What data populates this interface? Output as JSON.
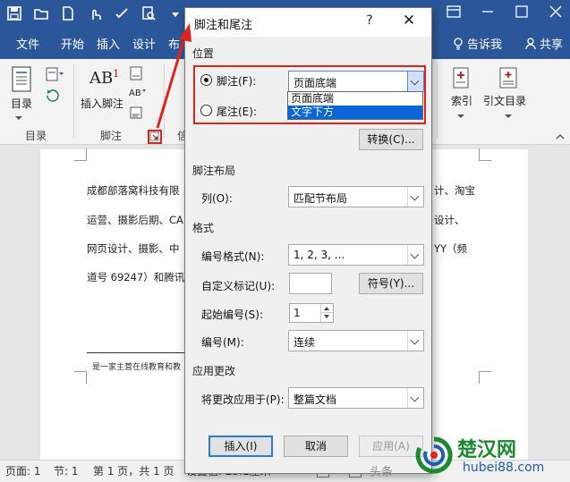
{
  "word": {
    "tabs": [
      "文件",
      "开始",
      "插入",
      "设计",
      "布"
    ],
    "tell_me": "告诉我",
    "share": "共享",
    "ribbon": {
      "toc_button": "目录",
      "toc_group": "目录",
      "insert_footnote_button": "插入脚注",
      "footnotes_group": "脚注",
      "citations_group_partial": "信",
      "index_button": "索引",
      "table_of_authorities_button": "引文目录",
      "ab_icon_text": "AB",
      "ab_superscript": "1"
    },
    "document_lines": [
      "成都部落窝科技有限",
      "运营、摄影后期、CA",
      "网页设计、摄影、中",
      "道号 69247）和腾讯"
    ],
    "document_lines_right": [
      "计、淘宝",
      "设计、",
      "YY（频",
      ""
    ],
    "footnote_text": "是一家主营在线教育和教",
    "status": {
      "page": "页面: 1",
      "section": "节: 1",
      "pages": "第 1 页，共 1 页",
      "position": "设置值: 23.1厘米"
    }
  },
  "dialog": {
    "title": "脚注和尾注",
    "help": "?",
    "close": "✕",
    "location_section": "位置",
    "footnote_label": "脚注(F):",
    "footnote_value": "页面底端",
    "endnote_label": "尾注(E):",
    "dropdown_options": [
      "页面底端",
      "文字下方"
    ],
    "dropdown_selected_index": 1,
    "convert_button": "转换(C)...",
    "layout_section": "脚注布局",
    "columns_label": "列(O):",
    "columns_value": "匹配节布局",
    "format_section": "格式",
    "number_format_label": "编号格式(N):",
    "number_format_value": "1, 2, 3, ...",
    "custom_mark_label": "自定义标记(U):",
    "custom_mark_value": "",
    "symbol_button": "符号(Y)...",
    "start_at_label": "起始编号(S):",
    "start_at_value": "1",
    "numbering_label": "编号(M):",
    "numbering_value": "连续",
    "apply_section": "应用更改",
    "apply_to_label": "将更改应用于(P):",
    "apply_to_value": "整篇文档",
    "insert_button": "插入(I)",
    "cancel_button": "取消",
    "apply_button": "应用(A)"
  },
  "watermark": {
    "title": "楚汉网",
    "url": "hubei88.com",
    "tag": "头条"
  },
  "colors": {
    "word_blue": "#2b579a",
    "annotation_red": "#e0241c",
    "selection_blue": "#0a66d8",
    "watermark_green": "#1a8a2e"
  }
}
